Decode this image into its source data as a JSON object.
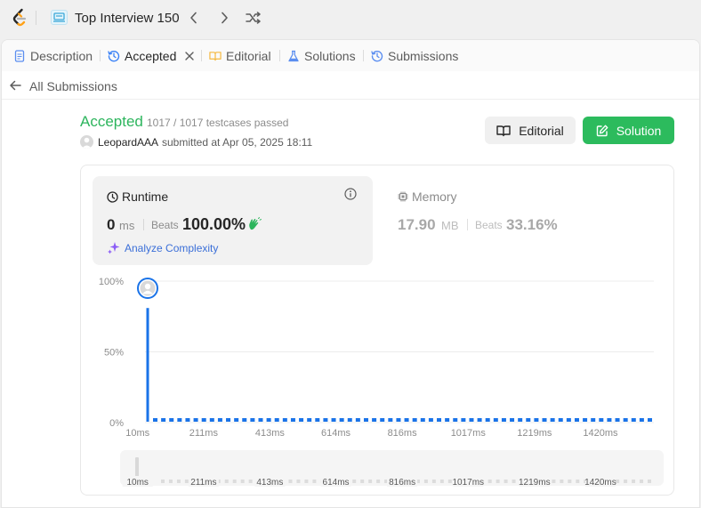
{
  "topbar": {
    "list_title": "Top Interview 150"
  },
  "tabs": [
    {
      "label": "Description",
      "icon": "document-icon"
    },
    {
      "label": "Accepted",
      "icon": "history-icon"
    },
    {
      "label": "Editorial",
      "icon": "book-icon"
    },
    {
      "label": "Solutions",
      "icon": "flask-icon"
    },
    {
      "label": "Submissions",
      "icon": "history-icon"
    }
  ],
  "subbar": {
    "back_label": "All Submissions"
  },
  "submission": {
    "status": "Accepted",
    "testcases": "1017 / 1017 testcases passed",
    "user": "LeopardAAA",
    "submitted_at": "submitted at Apr 05, 2025 18:11"
  },
  "actions": {
    "editorial_label": "Editorial",
    "solution_label": "Solution"
  },
  "runtime": {
    "title": "Runtime",
    "value": "0",
    "unit": "ms",
    "beats_label": "Beats",
    "beats_pct": "100.00%",
    "analyze_label": "Analyze Complexity"
  },
  "memory": {
    "title": "Memory",
    "value": "17.90",
    "unit": "MB",
    "beats_label": "Beats",
    "beats_pct": "33.16%"
  },
  "colors": {
    "accepted": "#2db55d",
    "solution_button": "#2cbb5d",
    "bar": "#1a73e8",
    "link": "#3b6fd8"
  },
  "chart_data": {
    "type": "bar",
    "yticks": [
      "0%",
      "50%",
      "100%"
    ],
    "ylim": [
      0,
      100
    ],
    "xticks": [
      "10ms",
      "211ms",
      "413ms",
      "614ms",
      "816ms",
      "1017ms",
      "1219ms",
      "1420ms"
    ],
    "tick_values": [
      10,
      211,
      413,
      614,
      816,
      1017,
      1219,
      1420
    ],
    "x_range": [
      0,
      1580
    ],
    "first_bar": {
      "x": 0,
      "value": 81
    },
    "other_bars": {
      "count": 62,
      "value": 2
    },
    "marker_position": "your submission at 0ms"
  }
}
